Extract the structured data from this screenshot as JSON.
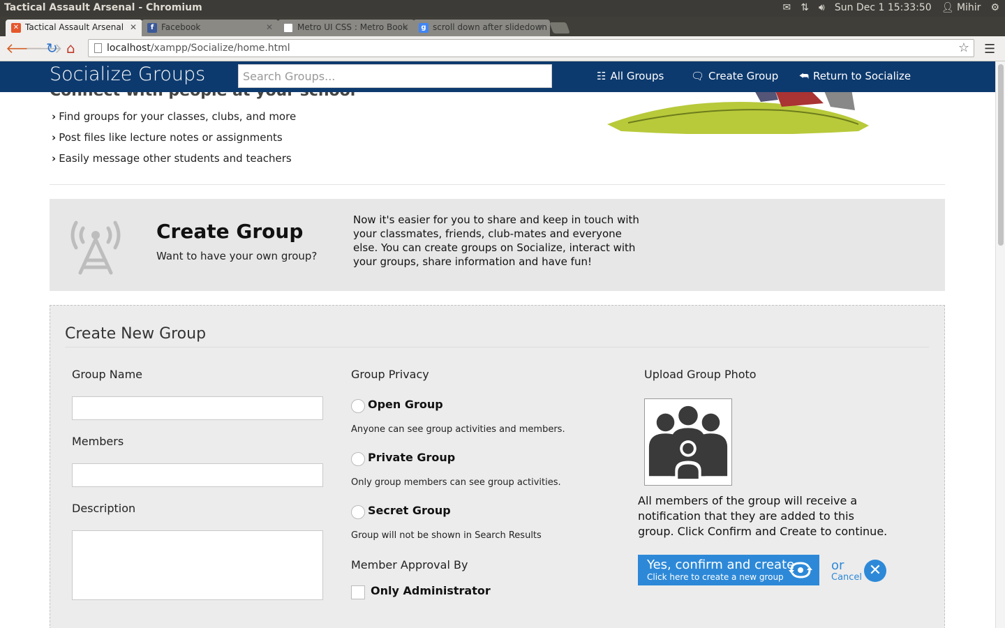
{
  "os": {
    "window_title": "Tactical Assault Arsenal - Chromium",
    "clock": "Sun Dec  1 15:33:50",
    "user": "Mihir"
  },
  "tabs": [
    {
      "label": "Tactical Assault Arsenal",
      "favicon_color": "#e5572c"
    },
    {
      "label": "Facebook",
      "favicon_color": "#3b5998"
    },
    {
      "label": "Metro UI CSS : Metro Book",
      "favicon_color": "#ffffff"
    },
    {
      "label": "scroll down after slidedown",
      "favicon_color": "#4285f4"
    }
  ],
  "toolbar": {
    "url_host": "localhost",
    "url_path": "/xampp/Socialize/home.html"
  },
  "navbar": {
    "brand": "Socialize Groups",
    "search_placeholder": "Search Groups...",
    "all_groups": "All Groups",
    "create_group": "Create Group",
    "return": "Return to Socialize"
  },
  "hero": {
    "title": "Connect with people at your school",
    "items": [
      "Find groups for your classes, clubs, and more",
      "Post files like lecture notes or assignments",
      "Easily message other students and teachers"
    ]
  },
  "promo": {
    "title": "Create Group",
    "subtitle": "Want to have your own group?",
    "description": "Now it's easier for you to share and keep in touch with your classmates, friends, club-mates and everyone else. You can create groups on Socialize, interact with your groups, share information and have fun!"
  },
  "form": {
    "title": "Create New Group",
    "group_name_label": "Group Name",
    "members_label": "Members",
    "description_label": "Description",
    "privacy_label": "Group Privacy",
    "options": [
      {
        "label": "Open Group",
        "desc": "Anyone can see group activities and members."
      },
      {
        "label": "Private Group",
        "desc": "Only group members can see group activities."
      },
      {
        "label": "Secret Group",
        "desc": "Group will not be shown in Search Results"
      }
    ],
    "approval_label": "Member Approval By",
    "approval_option": "Only Administrator",
    "upload_label": "Upload Group Photo",
    "notice": "All members of the group will receive a notification that they are added to this group. Click Confirm and Create to continue.",
    "confirm_main": "Yes, confirm and create",
    "confirm_sub": "Click here to create a new group",
    "or": "or",
    "cancel": "Cancel"
  }
}
